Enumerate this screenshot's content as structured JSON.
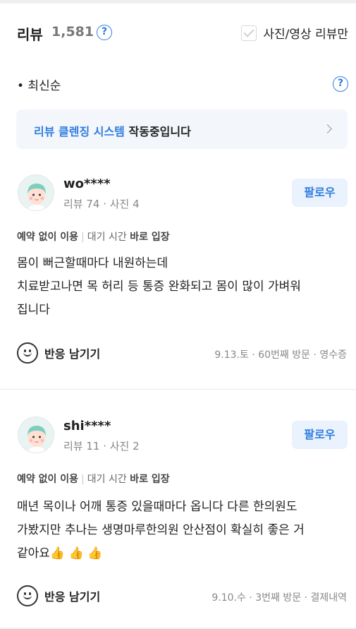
{
  "header": {
    "title": "리뷰",
    "count": "1,581",
    "help_icon": "help-circle-icon",
    "photo_filter_label": "사진/영상 리뷰만",
    "photo_filter_checked": false
  },
  "sort": {
    "label": "• 최신순"
  },
  "cleansing_banner": {
    "highlight": "리뷰 클렌징 시스템",
    "rest": " 작동중입니다",
    "icon": "chevron-right-icon"
  },
  "reviews": [
    {
      "username": "wo****",
      "stats": "리뷰 74 · 사진 4",
      "follow_label": "팔로우",
      "visit_prefix": "예약 없이 이용",
      "visit_wait_label": "대기 시간",
      "visit_wait_value": "바로 입장",
      "lines": [
        "몸이 뻐근할때마다 내원하는데",
        "치료받고나면 목 허리 등 통증 완화되고 몸이 많이 가벼워",
        "집니다"
      ],
      "react_label": "반응 남기기",
      "meta": "9.13.토 · 60번째 방문 · 영수증"
    },
    {
      "username": "shi****",
      "stats": "리뷰 11 · 사진 2",
      "follow_label": "팔로우",
      "visit_prefix": "예약 없이 이용",
      "visit_wait_label": "대기 시간",
      "visit_wait_value": "바로 입장",
      "lines": [
        "매년 목이나 어깨 통증 있을때마다 옵니다 다른 한의원도",
        "가봤지만 추나는 생명마루한의원 안산점이 확실히 좋은 거",
        "같아요👍 👍 👍"
      ],
      "react_label": "반응 남기기",
      "meta": "9.10.수 · 3번째 방문 · 결제내역"
    }
  ],
  "colors": {
    "accent": "#2f7de1",
    "follow_bg": "#eaf2fd",
    "banner_bg": "#f3f6fb"
  }
}
